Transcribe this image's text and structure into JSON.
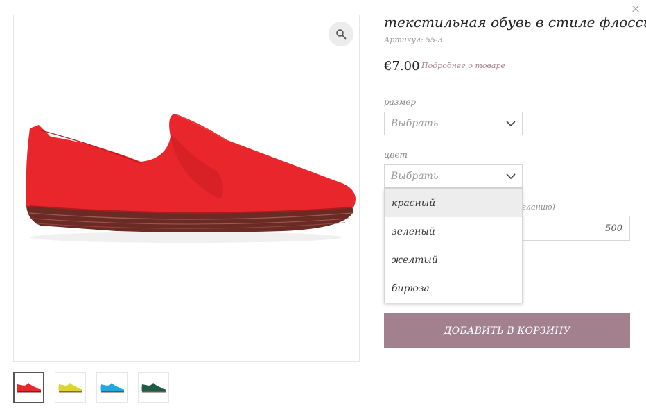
{
  "close_label": "×",
  "product": {
    "title": "текстильная обувь в стиле флосси",
    "sku": "Артикул: 55-3",
    "price": "€7.00",
    "details_link": "Подробнее о товаре"
  },
  "size_field": {
    "label": "размер",
    "value": "Выбрать"
  },
  "color_field": {
    "label": "цвет",
    "value": "Выбрать",
    "options": [
      "красный",
      "зеленый",
      "желтый",
      "бирюза"
    ],
    "highlighted_index": 0
  },
  "amount_field": {
    "label_visible_fragment": "желанию)",
    "value": "500"
  },
  "add_to_cart_label": "ДОБАВИТЬ В КОРЗИНУ",
  "thumbnails": [
    {
      "color": "#e8262b",
      "name": "red"
    },
    {
      "color": "#dcd437",
      "name": "yellow"
    },
    {
      "color": "#1ea9e0",
      "name": "turquoise"
    },
    {
      "color": "#1f5b47",
      "name": "green"
    }
  ],
  "colors": {
    "accent": "#a3808e",
    "link": "#a47f8e",
    "shoe_main": "#e8262b",
    "sole": "#6b2a24"
  }
}
